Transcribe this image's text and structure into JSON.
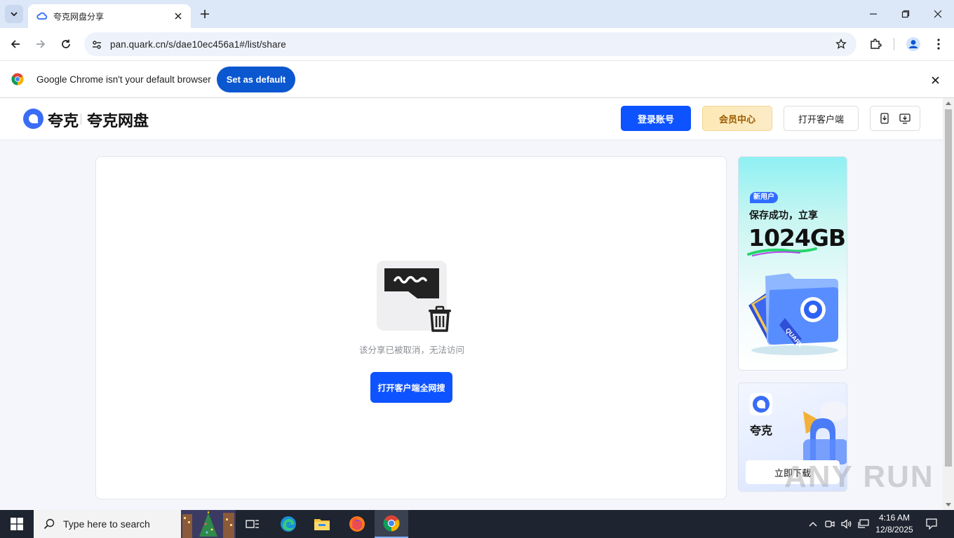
{
  "browser": {
    "tab_title": "夸克网盘分享",
    "url": "pan.quark.cn/s/dae10ec456a1#/list/share",
    "infobar_text": "Google Chrome isn't your default browser",
    "set_default_label": "Set as default"
  },
  "site": {
    "logo_text": "夸克",
    "logo_sub": "夸克网盘",
    "login_label": "登录账号",
    "vip_label": "会员中心",
    "client_label": "打开客户端"
  },
  "main": {
    "empty_message": "该分享已被取消，无法访问",
    "search_all_label": "打开客户端全网搜"
  },
  "ads": {
    "ad1_tag": "新用户",
    "ad1_line1": "保存成功，立享",
    "ad1_big": "1024GB",
    "ad1_folder_text": "QUARK",
    "ad2_name": "夸克",
    "ad2_button": "立即下载"
  },
  "watermark": "ANY RUN",
  "taskbar": {
    "search_placeholder": "Type here to search",
    "time": "4:16 AM",
    "date": "12/8/2025"
  },
  "colors": {
    "brand_blue": "#0d53ff",
    "chrome_blue": "#0b57d0"
  }
}
